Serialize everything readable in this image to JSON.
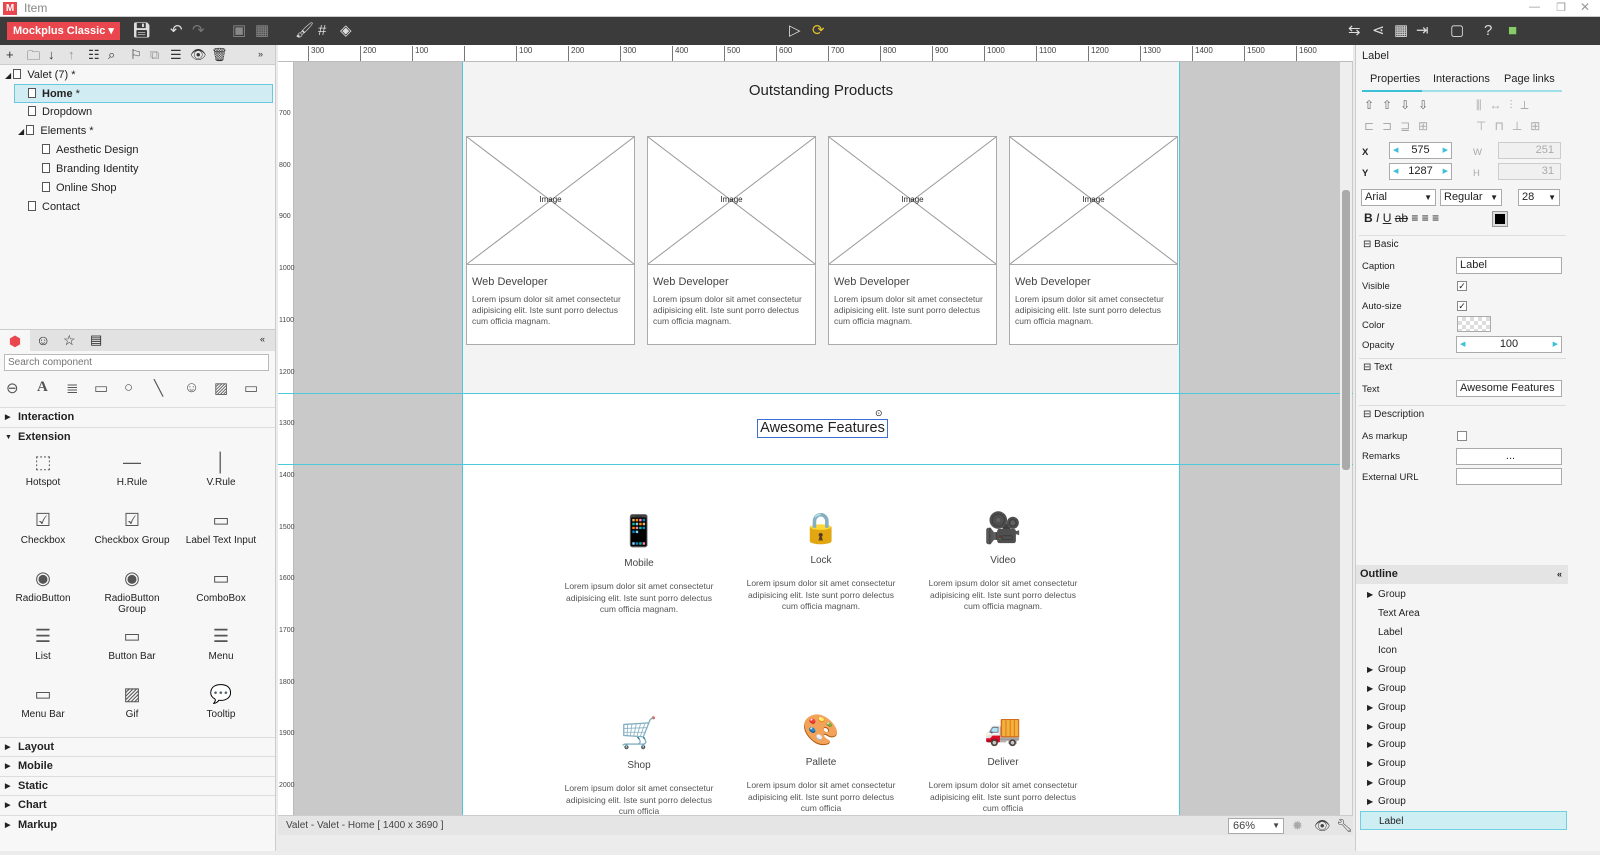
{
  "window": {
    "title": "Item",
    "logo": "M"
  },
  "toolbar": {
    "brand": "Mockplus Classic ▾",
    "icons": [
      "save-icon",
      "undo-icon",
      "redo-icon",
      "group-icon",
      "ungroup-icon",
      "format-brush-icon",
      "grid-icon",
      "fill-icon",
      "play-icon",
      "sync-icon",
      "export-icon",
      "share-icon",
      "qr-icon",
      "exit-icon",
      "fullscreen-icon",
      "help-icon",
      "user-icon"
    ]
  },
  "tree": {
    "root": "Valet (7)",
    "items": [
      {
        "label": "Home",
        "selected": true
      },
      {
        "label": "Dropdown"
      },
      {
        "label": "Elements"
      },
      {
        "label": "Aesthetic Design"
      },
      {
        "label": "Branding  Identity"
      },
      {
        "label": "Online Shop"
      },
      {
        "label": "Contact"
      }
    ]
  },
  "components": {
    "search_placeholder": "Search component",
    "sections": [
      "Interaction",
      "Extension",
      "Layout",
      "Mobile",
      "Static",
      "Chart",
      "Markup"
    ],
    "items": [
      {
        "label": "Hotspot",
        "icon": "⬚"
      },
      {
        "label": "H.Rule",
        "icon": "—"
      },
      {
        "label": "V.Rule",
        "icon": "│"
      },
      {
        "label": "Checkbox",
        "icon": "☑"
      },
      {
        "label": "Checkbox Group",
        "icon": "☑"
      },
      {
        "label": "Label Text Input",
        "icon": "▭"
      },
      {
        "label": "RadioButton",
        "icon": "◉"
      },
      {
        "label": "RadioButton Group",
        "icon": "◉"
      },
      {
        "label": "ComboBox",
        "icon": "▭"
      },
      {
        "label": "List",
        "icon": "☰"
      },
      {
        "label": "Button Bar",
        "icon": "▭"
      },
      {
        "label": "Menu",
        "icon": "☰"
      },
      {
        "label": "Menu Bar",
        "icon": "▭"
      },
      {
        "label": "Gif",
        "icon": "▨"
      },
      {
        "label": "Tooltip",
        "icon": "💬"
      }
    ]
  },
  "ruler": {
    "h": [
      "300",
      "200",
      "100",
      "",
      "100",
      "200",
      "300",
      "400",
      "500",
      "600",
      "700",
      "800",
      "900",
      "1000",
      "1100",
      "1200",
      "1300",
      "1400",
      "1500",
      "1600"
    ],
    "v": [
      "700",
      "800",
      "900",
      "1000",
      "1100",
      "1200",
      "1300",
      "1400",
      "1500",
      "1600",
      "1700",
      "1800",
      "1900",
      "2000"
    ]
  },
  "page": {
    "products_title": "Outstanding Products",
    "image_label": "Image",
    "cards": [
      {
        "title": "Web Developer",
        "desc": "Lorem ipsum dolor sit amet consectetur adipisicing elit. Iste sunt porro delectus cum officia magnam."
      },
      {
        "title": "Web Developer",
        "desc": "Lorem ipsum dolor sit amet consectetur adipisicing elit. Iste sunt porro delectus cum officia magnam."
      },
      {
        "title": "Web Developer",
        "desc": "Lorem ipsum dolor sit amet consectetur adipisicing elit. Iste sunt porro delectus cum officia magnam."
      },
      {
        "title": "Web Developer",
        "desc": "Lorem ipsum dolor sit amet consectetur adipisicing elit. Iste sunt porro delectus cum officia magnam."
      }
    ],
    "features_title": "Awesome Features",
    "features": [
      {
        "title": "Mobile",
        "icon": "📱",
        "desc": "Lorem ipsum dolor sit amet consectetur adipisicing elit. Iste sunt porro delectus cum officia magnam."
      },
      {
        "title": "Lock",
        "icon": "🔒",
        "desc": "Lorem ipsum dolor sit amet consectetur adipisicing elit. Iste sunt porro delectus cum officia magnam."
      },
      {
        "title": "Video",
        "icon": "🎥",
        "desc": "Lorem ipsum dolor sit amet consectetur adipisicing elit. Iste sunt porro delectus cum officia magnam."
      },
      {
        "title": "Shop",
        "icon": "🛒",
        "desc": "Lorem ipsum dolor sit amet consectetur adipisicing elit. Iste sunt porro delectus cum officia"
      },
      {
        "title": "Pallete",
        "icon": "🎨",
        "desc": "Lorem ipsum dolor sit amet consectetur adipisicing elit. Iste sunt porro delectus cum officia"
      },
      {
        "title": "Deliver",
        "icon": "🚚",
        "desc": "Lorem ipsum dolor sit amet consectetur adipisicing elit. Iste sunt porro delectus cum officia"
      }
    ]
  },
  "status": {
    "text": "Valet - Valet - Home [ 1400 x 3690 ]",
    "zoom": "66%"
  },
  "inspector": {
    "header": "Label",
    "tabs": [
      "Properties",
      "Interactions",
      "Page links"
    ],
    "x_label": "X",
    "x": "575",
    "y_label": "Y",
    "y": "1287",
    "w_label": "W",
    "w": "251",
    "h_label": "H",
    "h": "31",
    "font": "Arial",
    "style": "Regular",
    "size": "28",
    "text_color": "#000000",
    "basic": "Basic",
    "caption_label": "Caption",
    "caption": "Label",
    "visible_label": "Visible",
    "autosize_label": "Auto-size",
    "color_label": "Color",
    "opacity_label": "Opacity",
    "opacity": "100",
    "text_section": "Text",
    "text_label": "Text",
    "text": "Awesome Features",
    "desc_section": "Description",
    "markup_label": "As markup",
    "remarks_label": "Remarks",
    "remarks": "...",
    "url_label": "External URL",
    "outline_title": "Outline",
    "outline": [
      {
        "label": "Group",
        "expandable": true
      },
      {
        "label": "Text Area"
      },
      {
        "label": "Label"
      },
      {
        "label": "Icon"
      },
      {
        "label": "Group",
        "expandable": true
      },
      {
        "label": "Group",
        "expandable": true
      },
      {
        "label": "Group",
        "expandable": true
      },
      {
        "label": "Group",
        "expandable": true
      },
      {
        "label": "Group",
        "expandable": true
      },
      {
        "label": "Group",
        "expandable": true
      },
      {
        "label": "Group",
        "expandable": true
      },
      {
        "label": "Group",
        "expandable": true
      },
      {
        "label": "Label",
        "selected": true
      }
    ]
  },
  "colors": {
    "accent": "#e9474d",
    "guide": "#4ec9dc",
    "toolbar": "#3b3b3b"
  }
}
